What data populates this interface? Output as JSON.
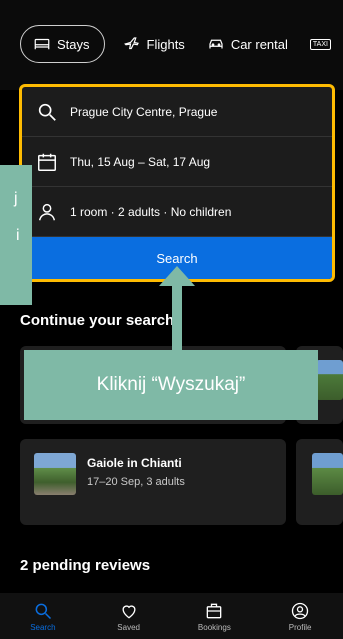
{
  "tabs": [
    {
      "label": "Stays",
      "icon": "bed-icon"
    },
    {
      "label": "Flights",
      "icon": "plane-icon"
    },
    {
      "label": "Car rental",
      "icon": "car-icon"
    },
    {
      "label": "TAXI",
      "icon": "taxi-icon"
    }
  ],
  "search": {
    "destination": "Prague City Centre, Prague",
    "dates": "Thu, 15 Aug – Sat, 17 Aug",
    "guests": "1 room · 2 adults · No children",
    "button_label": "Search"
  },
  "continue_section": {
    "title": "Continue your search",
    "cards": [
      {
        "title": "Gaiole in Chianti",
        "subtitle": "17–20 Sep, 3 adults"
      }
    ]
  },
  "reviews_section": {
    "title": "2 pending reviews"
  },
  "overlay": {
    "main_text": "Kliknij “Wyszukaj”",
    "side_text_1": "j",
    "side_text_2": "i"
  },
  "bottom_nav": [
    {
      "label": "Search",
      "icon": "search-icon"
    },
    {
      "label": "Saved",
      "icon": "heart-icon"
    },
    {
      "label": "Bookings",
      "icon": "briefcase-icon"
    },
    {
      "label": "Profile",
      "icon": "profile-icon"
    }
  ],
  "colors": {
    "accent": "#0a6ee0",
    "highlight": "#febb02",
    "overlay": "#7fb9a6"
  }
}
